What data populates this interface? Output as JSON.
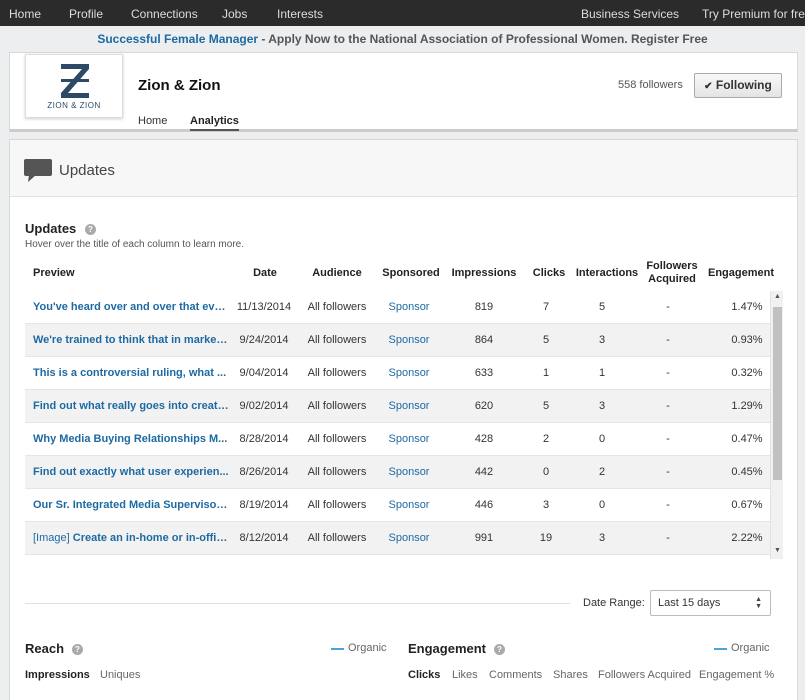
{
  "nav": {
    "left": [
      "Home",
      "Profile",
      "Connections",
      "Jobs",
      "Interests"
    ],
    "right": [
      "Business Services",
      "Try Premium for free"
    ]
  },
  "promo": {
    "link": "Successful Female Manager",
    "text": " - Apply Now to the National Association of Professional Women. Register Free"
  },
  "company": {
    "logo_text": "ZION & ZION",
    "name": "Zion & Zion",
    "followers": "558 followers",
    "follow_button": "Following",
    "tabs": [
      "Home",
      "Analytics"
    ]
  },
  "panel_title": "Updates",
  "updates": {
    "title": "Updates",
    "hint": "Hover over the title of each column to learn more.",
    "columns": [
      "Preview",
      "Date",
      "Audience",
      "Sponsored",
      "Impressions",
      "Clicks",
      "Interactions",
      "Followers Acquired",
      "Engagement"
    ],
    "rows": [
      {
        "preview": "You've heard over and over that eve...",
        "date": "11/13/2014",
        "audience": "All followers",
        "sponsored": "Sponsor",
        "impressions": "819",
        "clicks": "7",
        "interactions": "5",
        "followers": "-",
        "engagement": "1.47%"
      },
      {
        "preview": "We're trained to think that in marketi...",
        "date": "9/24/2014",
        "audience": "All followers",
        "sponsored": "Sponsor",
        "impressions": "864",
        "clicks": "5",
        "interactions": "3",
        "followers": "-",
        "engagement": "0.93%"
      },
      {
        "preview": "This is a controversial ruling, what ...",
        "date": "9/04/2014",
        "audience": "All followers",
        "sponsored": "Sponsor",
        "impressions": "633",
        "clicks": "1",
        "interactions": "1",
        "followers": "-",
        "engagement": "0.32%"
      },
      {
        "preview": "Find out what really goes into creati...",
        "date": "9/02/2014",
        "audience": "All followers",
        "sponsored": "Sponsor",
        "impressions": "620",
        "clicks": "5",
        "interactions": "3",
        "followers": "-",
        "engagement": "1.29%"
      },
      {
        "preview": "Why Media Buying Relationships M...",
        "date": "8/28/2014",
        "audience": "All followers",
        "sponsored": "Sponsor",
        "impressions": "428",
        "clicks": "2",
        "interactions": "0",
        "followers": "-",
        "engagement": "0.47%"
      },
      {
        "preview": "Find out exactly what user experien...",
        "date": "8/26/2014",
        "audience": "All followers",
        "sponsored": "Sponsor",
        "impressions": "442",
        "clicks": "0",
        "interactions": "2",
        "followers": "-",
        "engagement": "0.45%"
      },
      {
        "preview": "Our Sr. Integrated Media Supervisor...",
        "date": "8/19/2014",
        "audience": "All followers",
        "sponsored": "Sponsor",
        "impressions": "446",
        "clicks": "3",
        "interactions": "0",
        "followers": "-",
        "engagement": "0.67%"
      },
      {
        "preview_tag": "[Image]",
        "preview": " Create an in-home or in-offic...",
        "date": "8/12/2014",
        "audience": "All followers",
        "sponsored": "Sponsor",
        "impressions": "991",
        "clicks": "19",
        "interactions": "3",
        "followers": "-",
        "engagement": "2.22%"
      }
    ]
  },
  "date_range": {
    "label": "Date Range:",
    "value": "Last 15 days"
  },
  "reach": {
    "title": "Reach",
    "legend": "Organic",
    "tabs": [
      "Impressions",
      "Uniques"
    ]
  },
  "engagement": {
    "title": "Engagement",
    "legend": "Organic",
    "tabs": [
      "Clicks",
      "Likes",
      "Comments",
      "Shares",
      "Followers Acquired",
      "Engagement %"
    ]
  },
  "colors": {
    "link": "#1d6aa3",
    "nav_bg": "#2b2b2b",
    "legend": "#4aa3df"
  },
  "icons": {
    "help": "?",
    "check": "✔",
    "speech": "speech-bubble-icon"
  }
}
